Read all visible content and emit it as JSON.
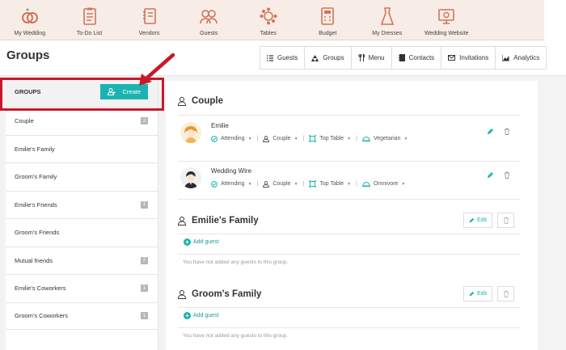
{
  "topnav": {
    "items": [
      {
        "label": "My Wedding",
        "icon": "rings-icon"
      },
      {
        "label": "To-Do List",
        "icon": "checklist-icon"
      },
      {
        "label": "Vendors",
        "icon": "notebook-icon"
      },
      {
        "label": "Guests",
        "icon": "guests-icon"
      },
      {
        "label": "Tables",
        "icon": "table-icon"
      },
      {
        "label": "Budget",
        "icon": "calculator-icon"
      },
      {
        "label": "My Dresses",
        "icon": "dress-icon"
      },
      {
        "label": "Wedding Website",
        "icon": "website-icon"
      }
    ]
  },
  "page": {
    "title": "Groups"
  },
  "tabs": [
    {
      "label": "Guests",
      "icon": "list-icon"
    },
    {
      "label": "Groups",
      "icon": "groups-icon",
      "active": true
    },
    {
      "label": "Menu",
      "icon": "cutlery-icon"
    },
    {
      "label": "Contacts",
      "icon": "address-book-icon"
    },
    {
      "label": "Invitations",
      "icon": "envelope-icon"
    },
    {
      "label": "Analytics",
      "icon": "chart-icon"
    }
  ],
  "sidebar": {
    "header": "GROUPS",
    "create_label": "Create",
    "items": [
      {
        "label": "Couple",
        "count": "2"
      },
      {
        "label": "Emilie's Family",
        "count": ""
      },
      {
        "label": "Groom's Family",
        "count": ""
      },
      {
        "label": "Emilie's Friends",
        "count": "1"
      },
      {
        "label": "Groom's Friends",
        "count": ""
      },
      {
        "label": "Mutual friends",
        "count": "2"
      },
      {
        "label": "Emilie's Coworkers",
        "count": "1"
      },
      {
        "label": "Groom's Coworkers",
        "count": "1"
      }
    ]
  },
  "groups": {
    "couple": {
      "title": "Couple",
      "guests": [
        {
          "name": "Emilie",
          "status": "Attending",
          "group": "Couple",
          "table": "Top Table",
          "menu": "Vegetarian"
        },
        {
          "name": "Wedding Wire",
          "status": "Attending",
          "group": "Couple",
          "table": "Top Table",
          "menu": "Omnivore"
        }
      ]
    },
    "emilies_family": {
      "title": "Emilie's Family",
      "edit_label": "Edit",
      "add_guest_label": "Add guest",
      "empty_note": "You have not added any guests to this group."
    },
    "grooms_family": {
      "title": "Groom's Family",
      "edit_label": "Edit",
      "add_guest_label": "Add guest",
      "empty_note": "You have not added any guests to this group."
    }
  },
  "colors": {
    "accent": "#1ab3b1",
    "nav_bg": "#f7ece6",
    "icon": "#d1745a",
    "annotation": "#c8192b"
  }
}
